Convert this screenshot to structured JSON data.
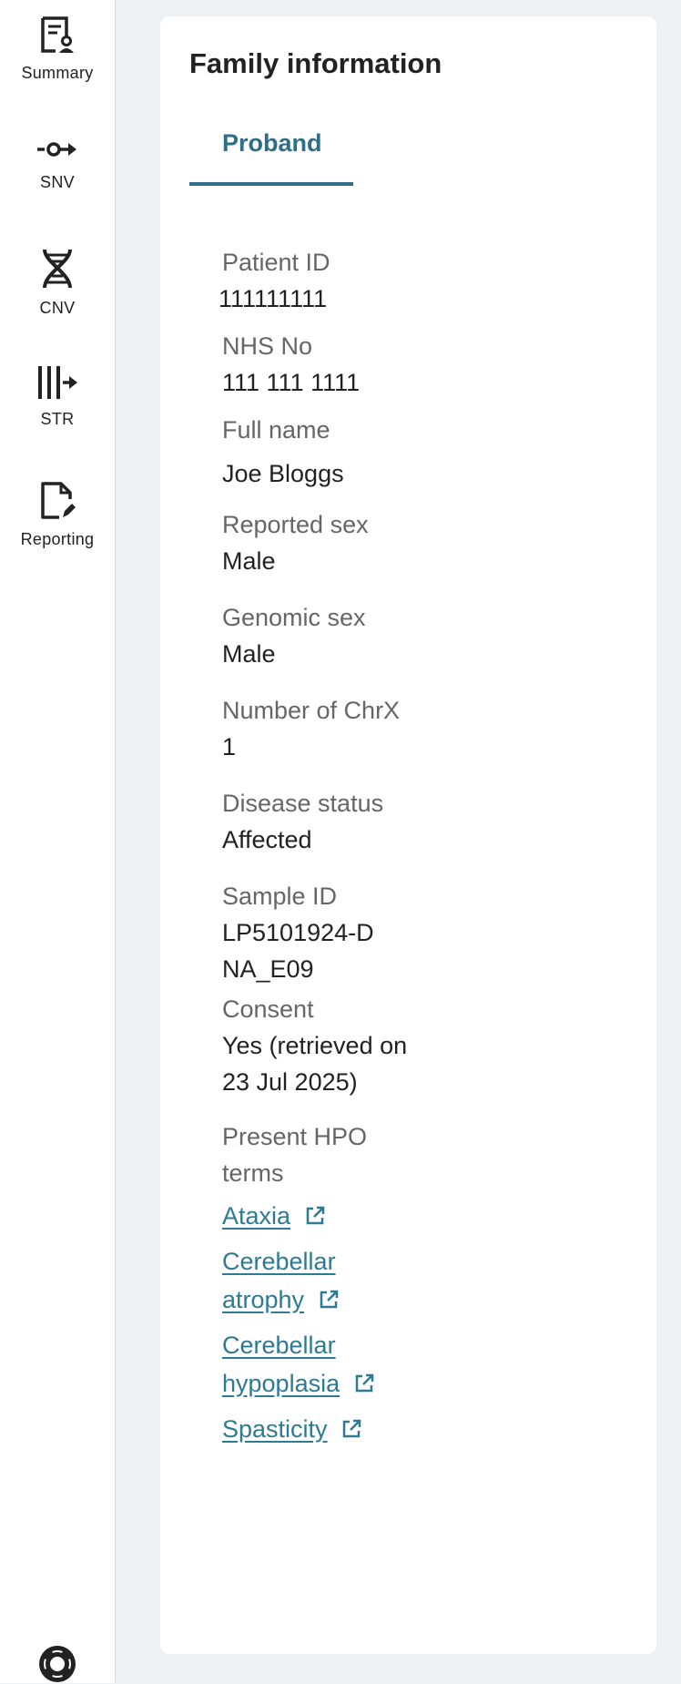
{
  "sidebar": {
    "items": [
      {
        "label": "Summary",
        "icon": "summary-icon"
      },
      {
        "label": "SNV",
        "icon": "snv-icon"
      },
      {
        "label": "CNV",
        "icon": "dna-icon"
      },
      {
        "label": "STR",
        "icon": "str-icon"
      },
      {
        "label": "Reporting",
        "icon": "report-edit-icon"
      }
    ],
    "help_icon": "lifebuoy-icon"
  },
  "card": {
    "title": "Family information",
    "tabs": [
      {
        "label": "Proband",
        "active": true
      }
    ],
    "fields": [
      {
        "label": "Patient ID",
        "value": "111111111"
      },
      {
        "label": "NHS No",
        "value": "111 111 1111"
      },
      {
        "label": "Full name",
        "value": "Joe Bloggs"
      },
      {
        "label": "Reported sex",
        "value": "Male"
      },
      {
        "label": "Genomic sex",
        "value": "Male"
      },
      {
        "label": "Number of ChrX",
        "value": "1"
      },
      {
        "label": "Disease status",
        "value": "Affected"
      },
      {
        "label": "Sample ID",
        "value": "LP5101924-DNA_E09"
      },
      {
        "label": "Consent",
        "value": "Yes (retrieved on 23 Jul 2025)"
      }
    ],
    "hpo_label": "Present HPO terms",
    "hpo_terms": [
      "Ataxia",
      "Cerebellar atrophy",
      "Cerebellar hypoplasia",
      "Spasticity"
    ]
  },
  "colors": {
    "accent": "#2e6e87",
    "link": "#2e7a93",
    "background": "#eef1f3"
  }
}
